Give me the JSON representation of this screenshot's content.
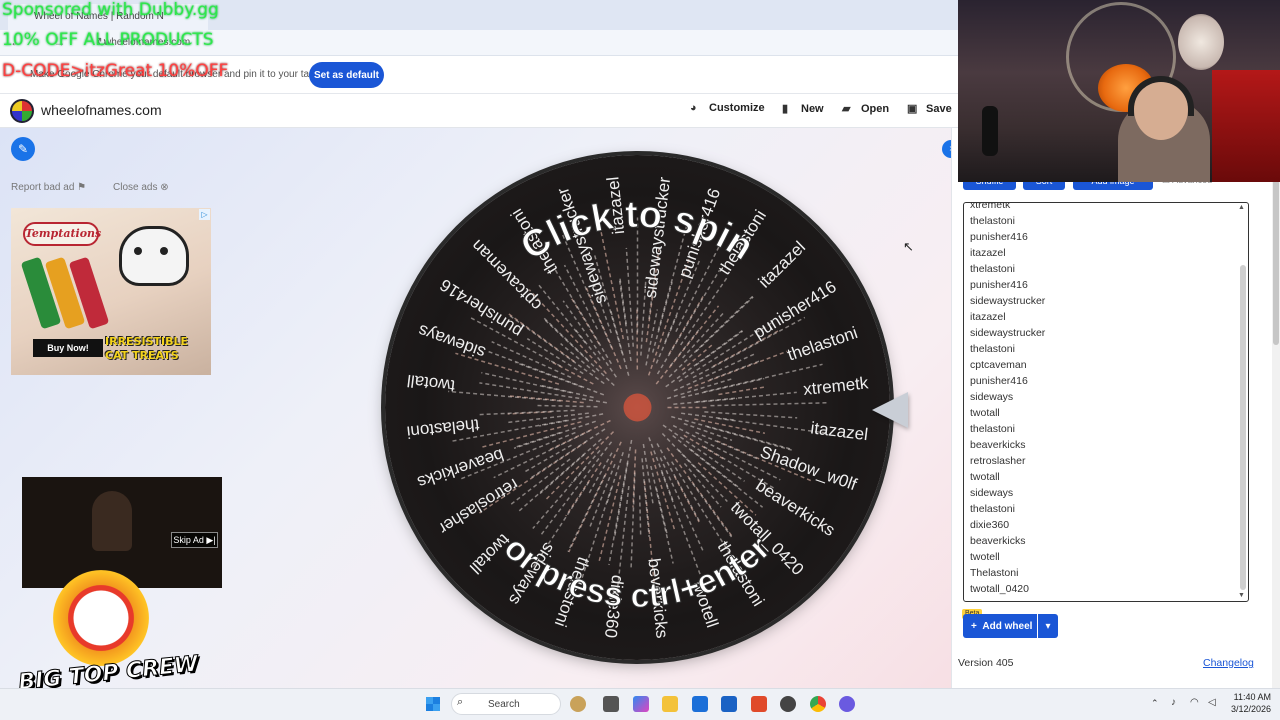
{
  "browser": {
    "tab_title": "Wheel of Names | Random N",
    "url": "wheelofnames.com",
    "infobar_text": "Make Google Chrome your default browser and pin it to your taskbar",
    "set_default_label": "Set as default"
  },
  "overlay": {
    "line1": "Sponsored with Dubby.gg",
    "line2": "10% OFF ALL PRODUCTS",
    "line3": "D-CODE>itzGreat 10%OFF"
  },
  "header": {
    "site_name": "wheelofnames.com",
    "customize": "Customize",
    "new": "New",
    "open": "Open",
    "save": "Save"
  },
  "sidebar": {
    "report_bad_ad": "Report bad ad",
    "close_ads": "Close ads"
  },
  "ad": {
    "brand": "Temptations",
    "buy_now": "Buy Now!",
    "slogan1": "IRRESISTIBLE",
    "slogan2": "CAT TREATS"
  },
  "video_ad": {
    "skip": "Skip Ad"
  },
  "stream_logo": {
    "text": "BIG TOP CREW"
  },
  "wheel": {
    "center_text_1": "Click to spin",
    "center_text_2": "or press ctrl+enter",
    "segments": [
      "xtremetk",
      "itazazel",
      "Shadow_w0lf",
      "beaverkicks",
      "twotall_0420",
      "thelastoni",
      "twotell",
      "beverkicks",
      "dixie360",
      "thelastoni",
      "sideways",
      "twotall",
      "retroslasher",
      "beaverkicks",
      "thelastoni",
      "twotall",
      "sideways",
      "punisher416",
      "cptcaveman",
      "thelastoni",
      "sidewaystrucker",
      "itazazel",
      "sidewaystrucker",
      "punisher416",
      "thelastoni",
      "itazazel",
      "punisher416",
      "thelastoni"
    ]
  },
  "panel": {
    "toolbar": {
      "shuffle": "Shuffle",
      "sort": "Sort",
      "add_image": "Add image",
      "advanced": "Advanced"
    },
    "entries": [
      "xtremetk",
      "thelastoni",
      "punisher416",
      "itazazel",
      "thelastoni",
      "punisher416",
      "sidewaystrucker",
      "itazazel",
      "sidewaystrucker",
      "thelastoni",
      "cptcaveman",
      "punisher416",
      "sideways",
      "twotall",
      "thelastoni",
      "beaverkicks",
      "retroslasher",
      "twotall",
      "sideways",
      "thelastoni",
      "dixie360",
      "beaverkicks",
      "twotell",
      "Thelastoni",
      "twotall_0420"
    ],
    "beta": "Beta",
    "add_wheel": "Add wheel",
    "version": "Version 405",
    "changelog": "Changelog"
  },
  "taskbar": {
    "search": "Search",
    "time": "11:40 AM",
    "date": "3/12/2026"
  }
}
